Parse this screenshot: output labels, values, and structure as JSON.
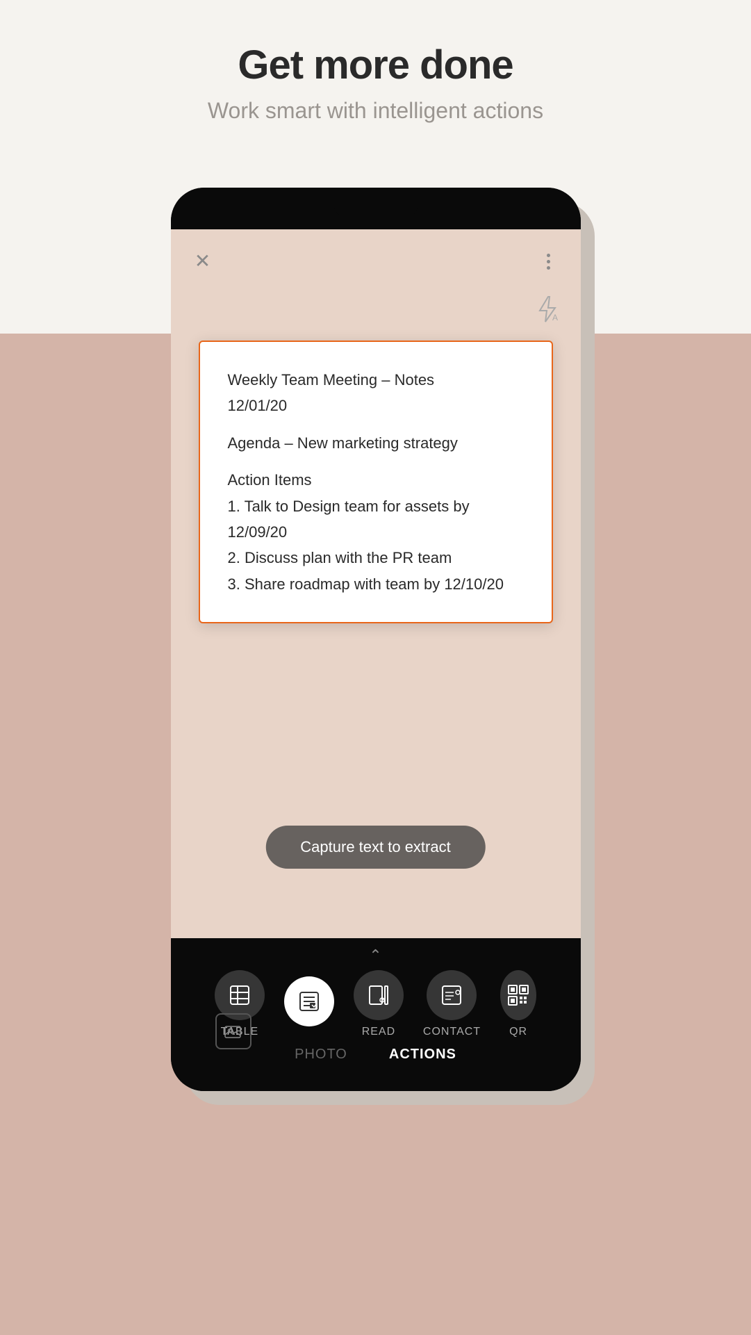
{
  "header": {
    "title": "Get more done",
    "subtitle": "Work smart with intelligent actions"
  },
  "phone": {
    "camera_button_label": "Capture text to extract",
    "notes": {
      "line1": "Weekly Team Meeting – Notes",
      "line2": "12/01/20",
      "line3": "Agenda – New marketing strategy",
      "line4": "Action Items",
      "line5": "1. Talk to Design team for assets by 12/09/20",
      "line6": "2. Discuss plan with the PR team",
      "line7": "3. Share roadmap with team by 12/10/20"
    },
    "bottom_tabs": {
      "photo_label": "PHOTO",
      "actions_label": "ACTIONS",
      "active": "ACTIONS"
    },
    "action_icons": [
      {
        "id": "table",
        "label": "TABLE",
        "active": false
      },
      {
        "id": "text",
        "label": "",
        "active": true
      },
      {
        "id": "read",
        "label": "READ",
        "active": false
      },
      {
        "id": "contact",
        "label": "CONTACT",
        "active": false
      },
      {
        "id": "qr",
        "label": "QR",
        "active": false
      }
    ]
  },
  "colors": {
    "accent_orange": "#e8661a",
    "bg_top": "#f5f3ef",
    "bg_bottom": "#d4b4a8",
    "phone_bg": "#1a1a1a",
    "camera_bg": "#e8d4c8"
  }
}
